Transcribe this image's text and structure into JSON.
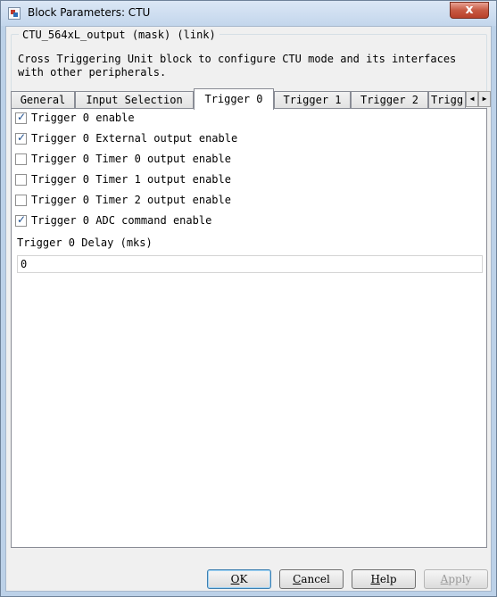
{
  "window": {
    "title": "Block Parameters: CTU",
    "close_glyph": "x"
  },
  "mask": {
    "legend": "CTU_564xL_output (mask) (link)",
    "description": "Cross Triggering Unit block to configure CTU mode and its interfaces with other peripherals."
  },
  "tabs": [
    {
      "label": "General"
    },
    {
      "label": "Input Selection"
    },
    {
      "label": "Trigger 0"
    },
    {
      "label": "Trigger 1"
    },
    {
      "label": "Trigger 2"
    },
    {
      "label": "Trigg"
    }
  ],
  "active_tab": "Trigger 0",
  "tab_scroll": {
    "left": "◀",
    "right": "▶"
  },
  "options": [
    {
      "label": "Trigger 0 enable",
      "checked": true
    },
    {
      "label": "Trigger 0 External output enable",
      "checked": true
    },
    {
      "label": "Trigger 0 Timer 0 output enable",
      "checked": false
    },
    {
      "label": "Trigger 0 Timer 1 output enable",
      "checked": false
    },
    {
      "label": "Trigger 0 Timer 2 output enable",
      "checked": false
    },
    {
      "label": "Trigger 0 ADC command enable",
      "checked": true
    }
  ],
  "delay": {
    "label": "Trigger 0 Delay (mks)",
    "value": "0"
  },
  "buttons": {
    "ok": {
      "mnemonic": "O",
      "rest": "K"
    },
    "cancel": {
      "mnemonic": "C",
      "rest": "ancel"
    },
    "help": {
      "mnemonic": "H",
      "rest": "elp"
    },
    "apply": {
      "mnemonic": "A",
      "rest": "pply",
      "enabled": false
    }
  },
  "colors": {
    "title_bar": "#c3d6ec",
    "close_button": "#c75a43",
    "check_mark": "#1f4f8f",
    "ok_focus": "#3c7fb1"
  }
}
